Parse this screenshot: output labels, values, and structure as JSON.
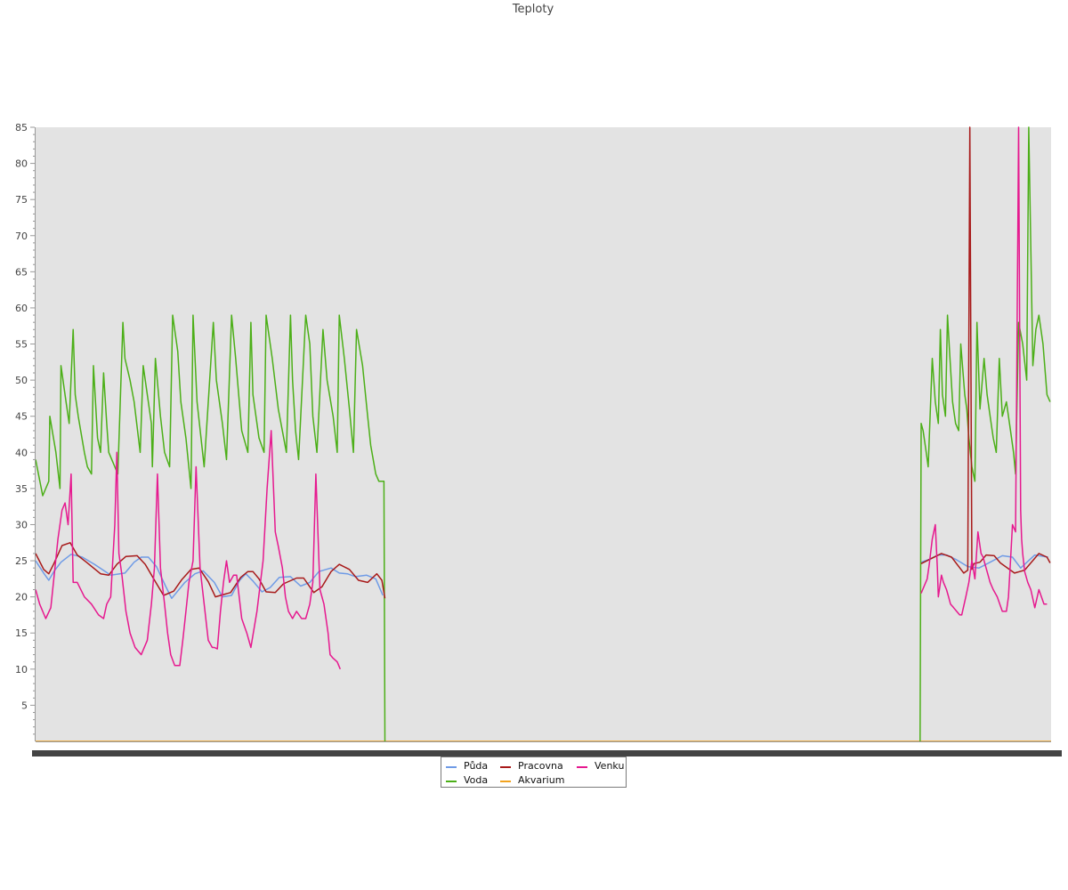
{
  "chart_data": {
    "type": "line",
    "title": "Teploty",
    "xlabel": "",
    "ylabel": "",
    "ylim": [
      0,
      85
    ],
    "yticks": [
      5,
      10,
      15,
      20,
      25,
      30,
      35,
      40,
      45,
      50,
      55,
      60,
      65,
      70,
      75,
      80,
      85
    ],
    "xlim": [
      0,
      1000
    ],
    "grid": false,
    "legend_position": "bottom-center",
    "plot_background": "#e3e3e3",
    "series": [
      {
        "name": "Půda",
        "color": "#6f9be6",
        "segments": [
          {
            "x": [
              0,
              8,
              13,
              18,
              25,
              35,
              46,
              58,
              74,
              88,
              97,
              104,
              111,
              119,
              128,
              134,
              147,
              157,
              165,
              176,
              184,
              193,
              201,
              207,
              214,
              223,
              231,
              240,
              251,
              261,
              270,
              279,
              291,
              299,
              307,
              315,
              326,
              335,
              342
            ],
            "y": [
              25,
              23.3,
              22.3,
              23.5,
              24.8,
              25.9,
              25.5,
              24.5,
              23,
              23.3,
              24.8,
              25.5,
              25.5,
              24.2,
              21.5,
              19.8,
              22,
              23.2,
              23.6,
              22,
              20,
              20.2,
              22.3,
              23.2,
              22.2,
              20.7,
              21.3,
              22.7,
              22.8,
              21.5,
              22,
              23.5,
              24,
              23.3,
              23.2,
              22.8,
              23,
              22.5,
              20.2
            ]
          },
          {
            "x": [
              872,
              880,
              889,
              897,
              906,
              918,
              929,
              940,
              952,
              962,
              970,
              984,
              997
            ],
            "y": [
              24.8,
              25.2,
              25.8,
              25.8,
              25.2,
              24.2,
              24,
              24.8,
              25.7,
              25.5,
              24,
              25.8,
              25.5
            ]
          }
        ]
      },
      {
        "name": "Voda",
        "color": "#4caf18",
        "segments": [
          {
            "x": [
              0,
              7,
              13,
              14,
              20,
              24,
              25,
              30,
              33,
              37,
              39,
              42,
              48,
              51,
              55,
              57,
              61,
              64,
              67,
              70,
              72,
              78,
              81,
              86,
              88,
              93,
              97,
              103,
              106,
              114,
              115,
              118,
              123,
              127,
              132,
              135,
              140,
              143,
              148,
              153,
              155,
              159,
              166,
              175,
              178,
              184,
              188,
              193,
              197,
              203,
              209,
              212,
              214,
              220,
              225,
              227,
              233,
              239,
              247,
              251,
              253,
              256,
              259,
              266,
              270,
              273,
              277,
              283,
              287,
              293,
              297,
              299,
              304,
              309,
              313,
              316,
              322,
              327,
              330,
              335,
              338,
              341,
              343,
              344
            ],
            "y": [
              39,
              34,
              36,
              45,
              40,
              35,
              52,
              47,
              44,
              57,
              48,
              45,
              40,
              38,
              37,
              52,
              42,
              40,
              51,
              44,
              40,
              38,
              37,
              58,
              53,
              50,
              47,
              40,
              52,
              44,
              38,
              53,
              45,
              40,
              38,
              59,
              54,
              47,
              42,
              35,
              59,
              47,
              38,
              58,
              50,
              44,
              39,
              59,
              53,
              43,
              40,
              58,
              48,
              42,
              40,
              59,
              53,
              46,
              40,
              59,
              50,
              43,
              39,
              59,
              55,
              45,
              40,
              57,
              50,
              45,
              40,
              59,
              53,
              46,
              40,
              57,
              52,
              45,
              41,
              37,
              36,
              36,
              36,
              0
            ]
          },
          {
            "x": [
              871,
              872,
              874,
              877,
              879,
              883,
              886,
              889,
              891,
              893,
              896,
              898,
              900,
              903,
              906,
              909,
              911,
              915,
              917,
              919,
              922,
              925,
              927,
              930,
              934,
              937,
              940,
              943,
              946,
              949,
              952,
              956,
              960,
              963,
              965,
              968,
              972,
              976,
              978,
              982,
              985,
              988,
              992,
              996,
              999
            ],
            "y": [
              0,
              44,
              43,
              40,
              38,
              53,
              47,
              44,
              57,
              48,
              45,
              59,
              54,
              47,
              44,
              43,
              55,
              48,
              46,
              42,
              38,
              36,
              58,
              46,
              53,
              48,
              45,
              42,
              40,
              53,
              45,
              47,
              43,
              40,
              37,
              58,
              55,
              50,
              85,
              52,
              57,
              59,
              55,
              48,
              47
            ]
          }
        ]
      },
      {
        "name": "Pracovna",
        "color": "#a81a1a",
        "segments": [
          {
            "x": [
              0,
              8,
              13,
              18,
              26,
              34,
              41,
              50,
              64,
              72,
              80,
              89,
              100,
              108,
              118,
              126,
              136,
              144,
              153,
              161,
              170,
              177,
              192,
              202,
              209,
              214,
              220,
              227,
              236,
              244,
              257,
              264,
              274,
              282,
              291,
              299,
              309,
              318,
              327,
              336,
              341,
              344
            ],
            "y": [
              26,
              23.8,
              23.2,
              24.6,
              27.1,
              27.5,
              25.8,
              24.8,
              23.2,
              23,
              24.5,
              25.6,
              25.7,
              24.5,
              22.1,
              20.2,
              20.8,
              22.4,
              23.8,
              24,
              22.1,
              20,
              20.6,
              22.7,
              23.5,
              23.5,
              22.5,
              20.7,
              20.6,
              21.8,
              22.6,
              22.6,
              20.6,
              21.4,
              23.5,
              24.5,
              23.8,
              22.3,
              22,
              23.2,
              22.3,
              19.8
            ]
          },
          {
            "x": [
              872,
              882,
              892,
              902,
              908,
              914,
              918,
              920,
              922,
              924,
              930,
              936,
              944,
              950,
              964,
              974,
              988,
              996,
              999
            ],
            "y": [
              24.6,
              25.3,
              26,
              25.5,
              24.4,
              23.3,
              23.7,
              85,
              23.8,
              24.6,
              24.8,
              25.8,
              25.7,
              24.7,
              23.3,
              23.7,
              26,
              25.5,
              24.7
            ]
          }
        ]
      },
      {
        "name": "Akvarium",
        "color": "#f2a31f",
        "segments": [
          {
            "x": [
              0,
              1000
            ],
            "y": [
              0,
              0
            ]
          }
        ]
      },
      {
        "name": "Venku",
        "color": "#e6198f",
        "segments": [
          {
            "x": [
              0,
              4,
              10,
              15,
              22,
              26,
              29,
              32,
              35,
              37,
              41,
              48,
              55,
              62,
              67,
              70,
              74,
              78,
              80,
              82,
              85,
              89,
              93,
              98,
              104,
              110,
              114,
              117,
              120,
              123,
              127,
              130,
              133,
              137,
              142,
              145,
              148,
              151,
              155,
              158,
              162,
              166,
              170,
              174,
              176,
              179,
              182,
              185,
              188,
              191,
              195,
              198,
              203,
              208,
              212,
              218,
              224,
              228,
              232,
              236,
              239,
              243,
              246,
              249,
              253,
              257,
              262,
              266,
              270,
              273,
              276,
              280,
              284,
              286,
              288,
              290,
              293,
              297,
              300,
              303,
              307,
              311,
              315,
              317,
              320,
              323,
              325,
              328,
              331,
              334,
              337,
              340,
              342,
              343
            ],
            "y": [
              21,
              19,
              17,
              18.5,
              28,
              32,
              33,
              30,
              37,
              22,
              22,
              20,
              19,
              17.5,
              17,
              19,
              20,
              30,
              40,
              26,
              23,
              18,
              15,
              13,
              12,
              14,
              19,
              24,
              37,
              24,
              19,
              15,
              12,
              10.5,
              10.5,
              14,
              18,
              22,
              25,
              38,
              24,
              19,
              14,
              13,
              13,
              12.8,
              18,
              22,
              25,
              22,
              23,
              23,
              17,
              15,
              13,
              18,
              25,
              35,
              43,
              29,
              27,
              24,
              20,
              18,
              17,
              18,
              17,
              17,
              19,
              22,
              37,
              21,
              19,
              17,
              15,
              12,
              11.5,
              11,
              10
            ]
          },
          {
            "x": [
              872,
              875,
              878,
              880,
              883,
              886,
              888,
              889,
              890,
              892,
              894,
              897,
              899,
              901,
              904,
              907,
              910,
              912,
              916,
              919,
              922,
              925,
              928,
              931,
              933,
              935,
              937,
              940,
              943,
              947,
              952,
              956,
              958,
              960,
              962,
              965,
              968,
              970,
              971,
              972,
              974,
              977,
              980,
              984,
              988,
              993,
              996,
              999
            ],
            "y": [
              20.5,
              21.5,
              22.5,
              24.5,
              28,
              30,
              24,
              20,
              21,
              23,
              22,
              21,
              20,
              19,
              18.5,
              18,
              17.5,
              17.5,
              20,
              22,
              25,
              22.5,
              29,
              26,
              25.5,
              24.5,
              23.5,
              22,
              21,
              20,
              18,
              18,
              20,
              25,
              30,
              29,
              85,
              32,
              28,
              26,
              23.5,
              22,
              21,
              18.5,
              21,
              19,
              19
            ]
          }
        ]
      }
    ]
  }
}
